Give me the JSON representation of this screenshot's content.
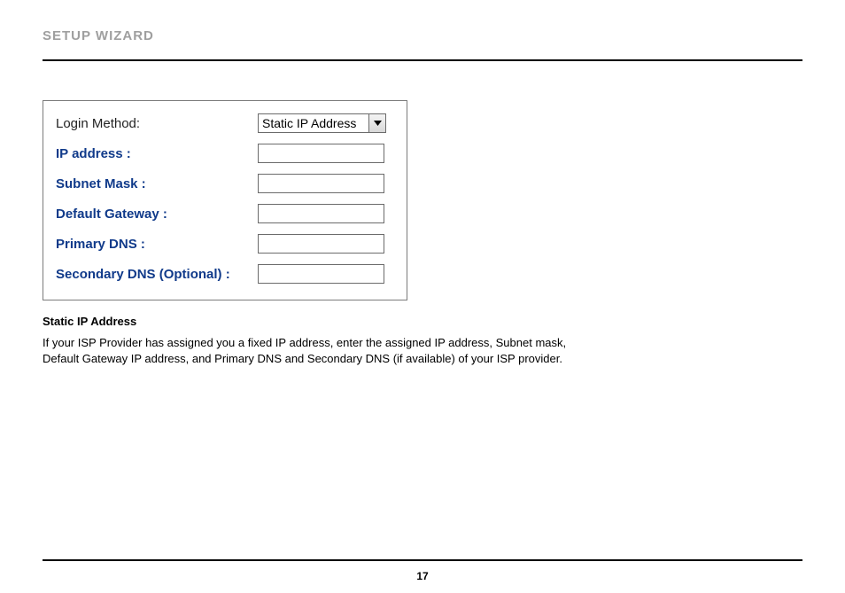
{
  "header": {
    "title": "SETUP WIZARD"
  },
  "form": {
    "login_method": {
      "label": "Login Method:",
      "value": "Static IP Address"
    },
    "ip_address": {
      "label": "IP address :",
      "value": ""
    },
    "subnet_mask": {
      "label": "Subnet Mask :",
      "value": ""
    },
    "default_gateway": {
      "label": "Default Gateway :",
      "value": ""
    },
    "primary_dns": {
      "label": "Primary DNS :",
      "value": ""
    },
    "secondary_dns": {
      "label": "Secondary DNS (Optional) :",
      "value": ""
    }
  },
  "section": {
    "subtitle": "Static IP Address",
    "body": "If your ISP Provider has assigned you a fixed IP address, enter the assigned IP address, Subnet mask, Default Gateway IP address, and Primary DNS and Secondary DNS (if available) of your ISP provider."
  },
  "page_number": "17"
}
